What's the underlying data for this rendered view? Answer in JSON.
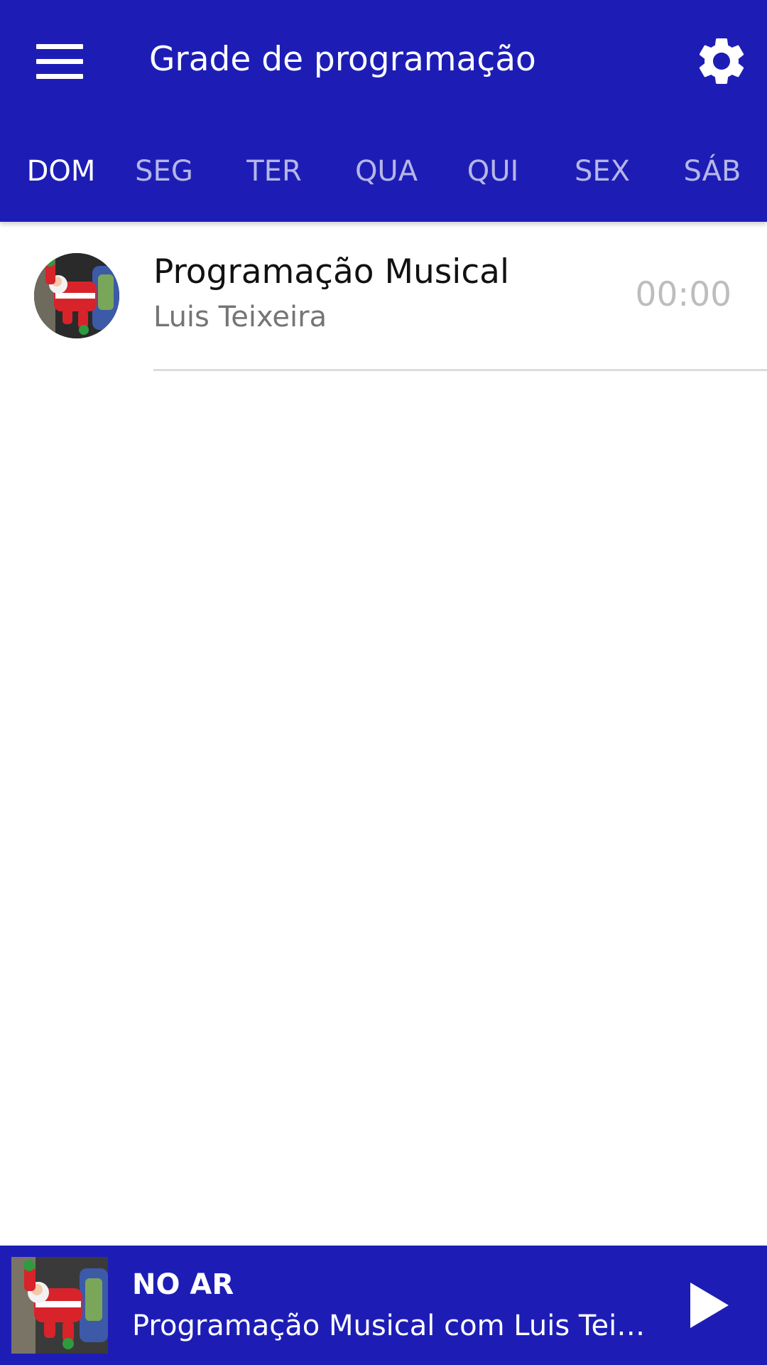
{
  "appbar": {
    "title": "Grade de programação",
    "menu_icon": "menu-icon",
    "settings_icon": "gear-icon",
    "background": "#1d1db6"
  },
  "tabs": [
    {
      "label": "DOM",
      "active": true
    },
    {
      "label": "SEG",
      "active": false
    },
    {
      "label": "TER",
      "active": false
    },
    {
      "label": "QUA",
      "active": false
    },
    {
      "label": "QUI",
      "active": false
    },
    {
      "label": "SEX",
      "active": false
    },
    {
      "label": "SÁB",
      "active": false
    }
  ],
  "schedule": [
    {
      "title": "Programação Musical",
      "host": "Luis Teixeira",
      "time": "00:00"
    }
  ],
  "player": {
    "label": "NO AR",
    "now_playing": "Programação Musical com Luis Teixeira",
    "play_icon": "play-icon"
  }
}
